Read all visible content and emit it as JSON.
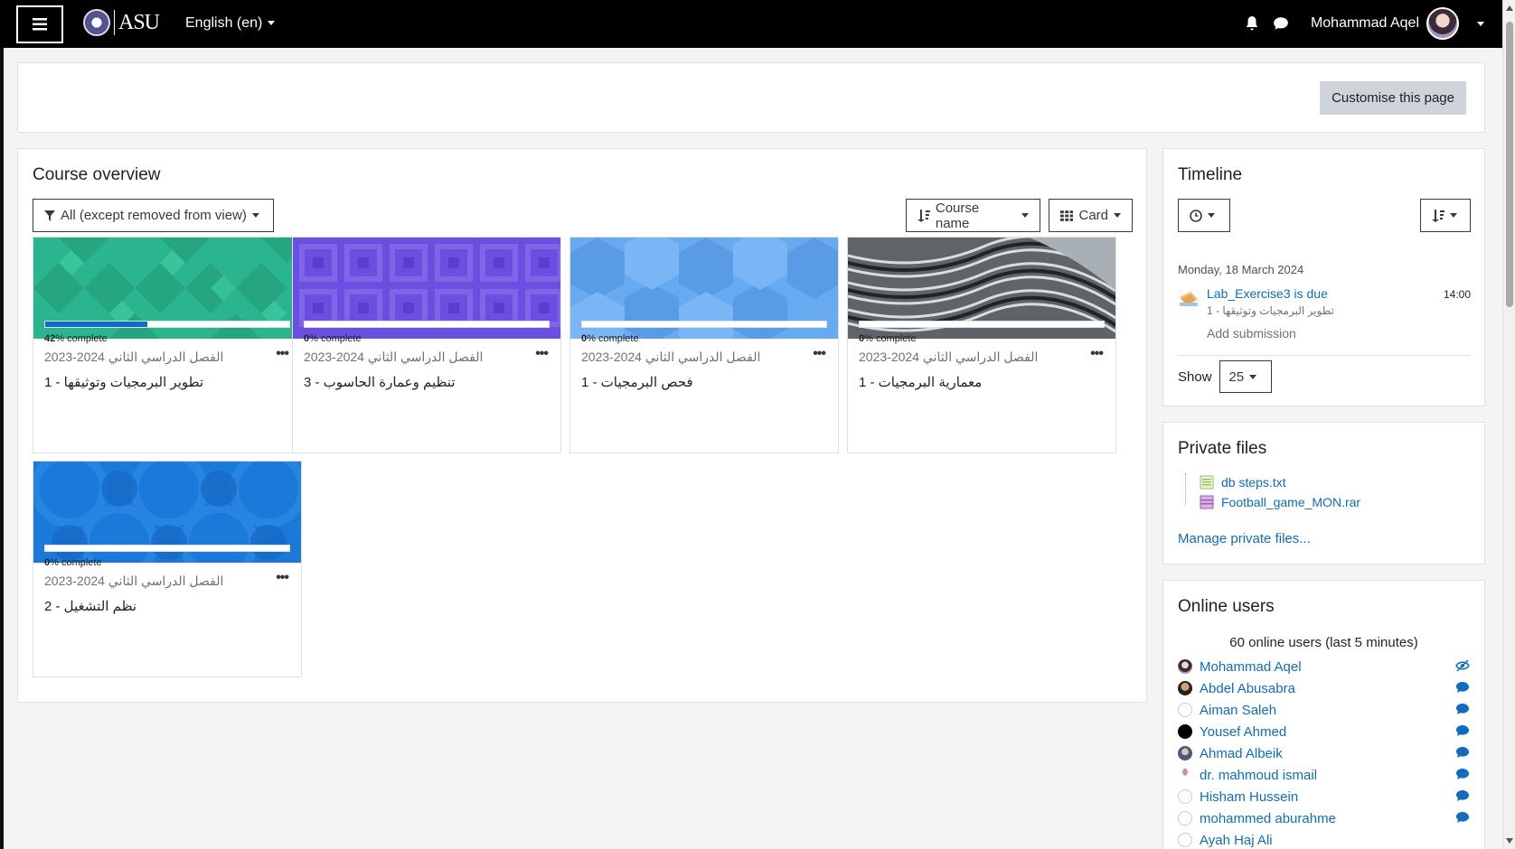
{
  "navbar": {
    "logo_text": "ASU",
    "language": "English (en)",
    "user_name": "Mohammad Aqel"
  },
  "top": {
    "customise_label": "Customise this page"
  },
  "course_overview": {
    "title": "Course overview",
    "filter_label": "All (except removed from view)",
    "sort_label": "Course name",
    "view_label": "Card",
    "courses": [
      {
        "category": "الفصل الدراسي الثاني 2024-2023",
        "name": "تطوير البرمجيات وتوثيقها - 1",
        "progress_pct": 42,
        "progress_label": "42",
        "progress_suffix": "% complete"
      },
      {
        "category": "الفصل الدراسي الثاني 2024-2023",
        "name": "تنظيم وعمارة الحاسوب - 3",
        "progress_pct": 0,
        "progress_label": "0",
        "progress_suffix": "% complete"
      },
      {
        "category": "الفصل الدراسي الثاني 2024-2023",
        "name": "فحص البرمجيات - 1",
        "progress_pct": 0,
        "progress_label": "0",
        "progress_suffix": "% complete"
      },
      {
        "category": "الفصل الدراسي الثاني 2024-2023",
        "name": "معمارية البرمجيات - 1",
        "progress_pct": 0,
        "progress_label": "0",
        "progress_suffix": "% complete"
      },
      {
        "category": "الفصل الدراسي الثاني 2024-2023",
        "name": "نظم التشغيل - 2",
        "progress_pct": 0,
        "progress_label": "0",
        "progress_suffix": "% complete"
      }
    ]
  },
  "timeline": {
    "title": "Timeline",
    "date": "Monday, 18 March 2024",
    "event_link": "Lab_Exercise3 is due",
    "event_course": "تطوير البرمجيات وتوثيقها - 1",
    "event_time": "14:00",
    "event_action": "Add submission",
    "show_label": "Show",
    "show_value": "25"
  },
  "private_files": {
    "title": "Private files",
    "files": [
      "db steps.txt",
      "Football_game_MON.rar"
    ],
    "manage_link": "Manage private files..."
  },
  "online_users": {
    "title": "Online users",
    "count_text": "60 online users (last 5 minutes)",
    "users": [
      "Mohammad Aqel",
      "Abdel Abusabra",
      "Aiman Saleh",
      "Yousef Ahmed",
      "Ahmad Albeik",
      "dr. mahmoud ismail",
      "Hisham Hussein",
      "mohammed aburahme",
      "Ayah Haj Ali"
    ]
  },
  "colors": {
    "accent": "#0f6cbf",
    "navbar": "#000000",
    "button_secondary": "#ced4da"
  }
}
